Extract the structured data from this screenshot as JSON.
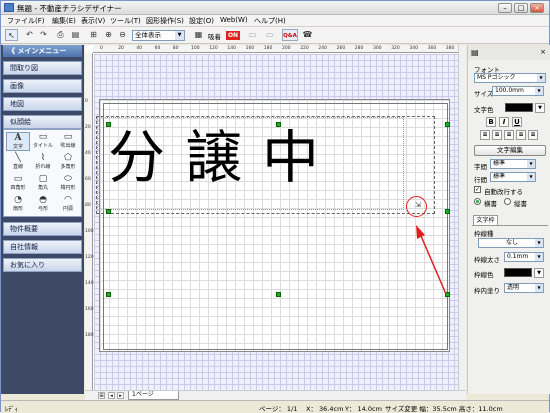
{
  "window": {
    "title": "無題 - 不動産チラシデザイナー"
  },
  "menubar": {
    "items": [
      "ファイル(F)",
      "編集(E)",
      "表示(V)",
      "ツール(T)",
      "図形操作(S)",
      "設定(O)",
      "Web(W)",
      "ヘルプ(H)"
    ]
  },
  "toolbar": {
    "zoom_value": "全体表示",
    "grid_label": "吸着",
    "grid_state": "ON",
    "qa_label": "Q&A"
  },
  "left_panel": {
    "header": "メインメニュー",
    "items": [
      "間取り図",
      "画像",
      "地図",
      "似顔絵"
    ],
    "shapes": [
      "文字",
      "タイトル",
      "吹出線",
      "直線",
      "折れ線",
      "多角形",
      "四角形",
      "角丸",
      "楕円形",
      "扇形",
      "弓形",
      "円弧"
    ],
    "bottom_items": [
      "物件概要",
      "自社情報",
      "お気に入り"
    ]
  },
  "ruler": {
    "h_ticks": [
      "0",
      "20",
      "40",
      "60",
      "80",
      "100",
      "120",
      "140",
      "160",
      "180",
      "200",
      "220",
      "240",
      "260",
      "280",
      "300",
      "320",
      "340",
      "360",
      "380"
    ],
    "v_ticks": [
      "0",
      "20",
      "40",
      "60",
      "80",
      "100",
      "120",
      "140",
      "160",
      "180"
    ]
  },
  "canvas": {
    "main_text": "分譲中",
    "page_tab": "1ページ"
  },
  "right_panel": {
    "font_label": "フォント",
    "font_value": "MS Pゴシック",
    "size_label": "サイズ",
    "size_value": "100.0mm",
    "color_label": "文字色",
    "bold": "B",
    "italic": "I",
    "underline": "U",
    "edit_button": "文字編集",
    "char_spacing_label": "字間",
    "char_spacing_value": "標準",
    "line_spacing_label": "行間",
    "line_spacing_value": "標準",
    "autowrap_label": "自動改行する",
    "horizontal_label": "横書",
    "vertical_label": "縦書",
    "tab_label": "文字枠",
    "frame_type_label": "枠線種",
    "frame_type_value": "なし",
    "frame_width_label": "枠線太さ",
    "frame_width_value": "0.1mm",
    "frame_color_label": "枠線色",
    "frame_fill_label": "枠内塗り",
    "frame_fill_value": "透明"
  },
  "statusbar": {
    "ready": "ﾚﾃﾞｨ",
    "page": "ページ： 1/1",
    "x": "X： 36.4cm",
    "y": "Y： 14.0cm",
    "size": "サイズ変更 幅：35.5cm 高さ：11.0cm"
  },
  "colors": {
    "accent_red": "#e02020",
    "handle_green": "#22aa22",
    "left_panel_bg": "#3d4966",
    "grid_color": "#c9cbe9"
  }
}
